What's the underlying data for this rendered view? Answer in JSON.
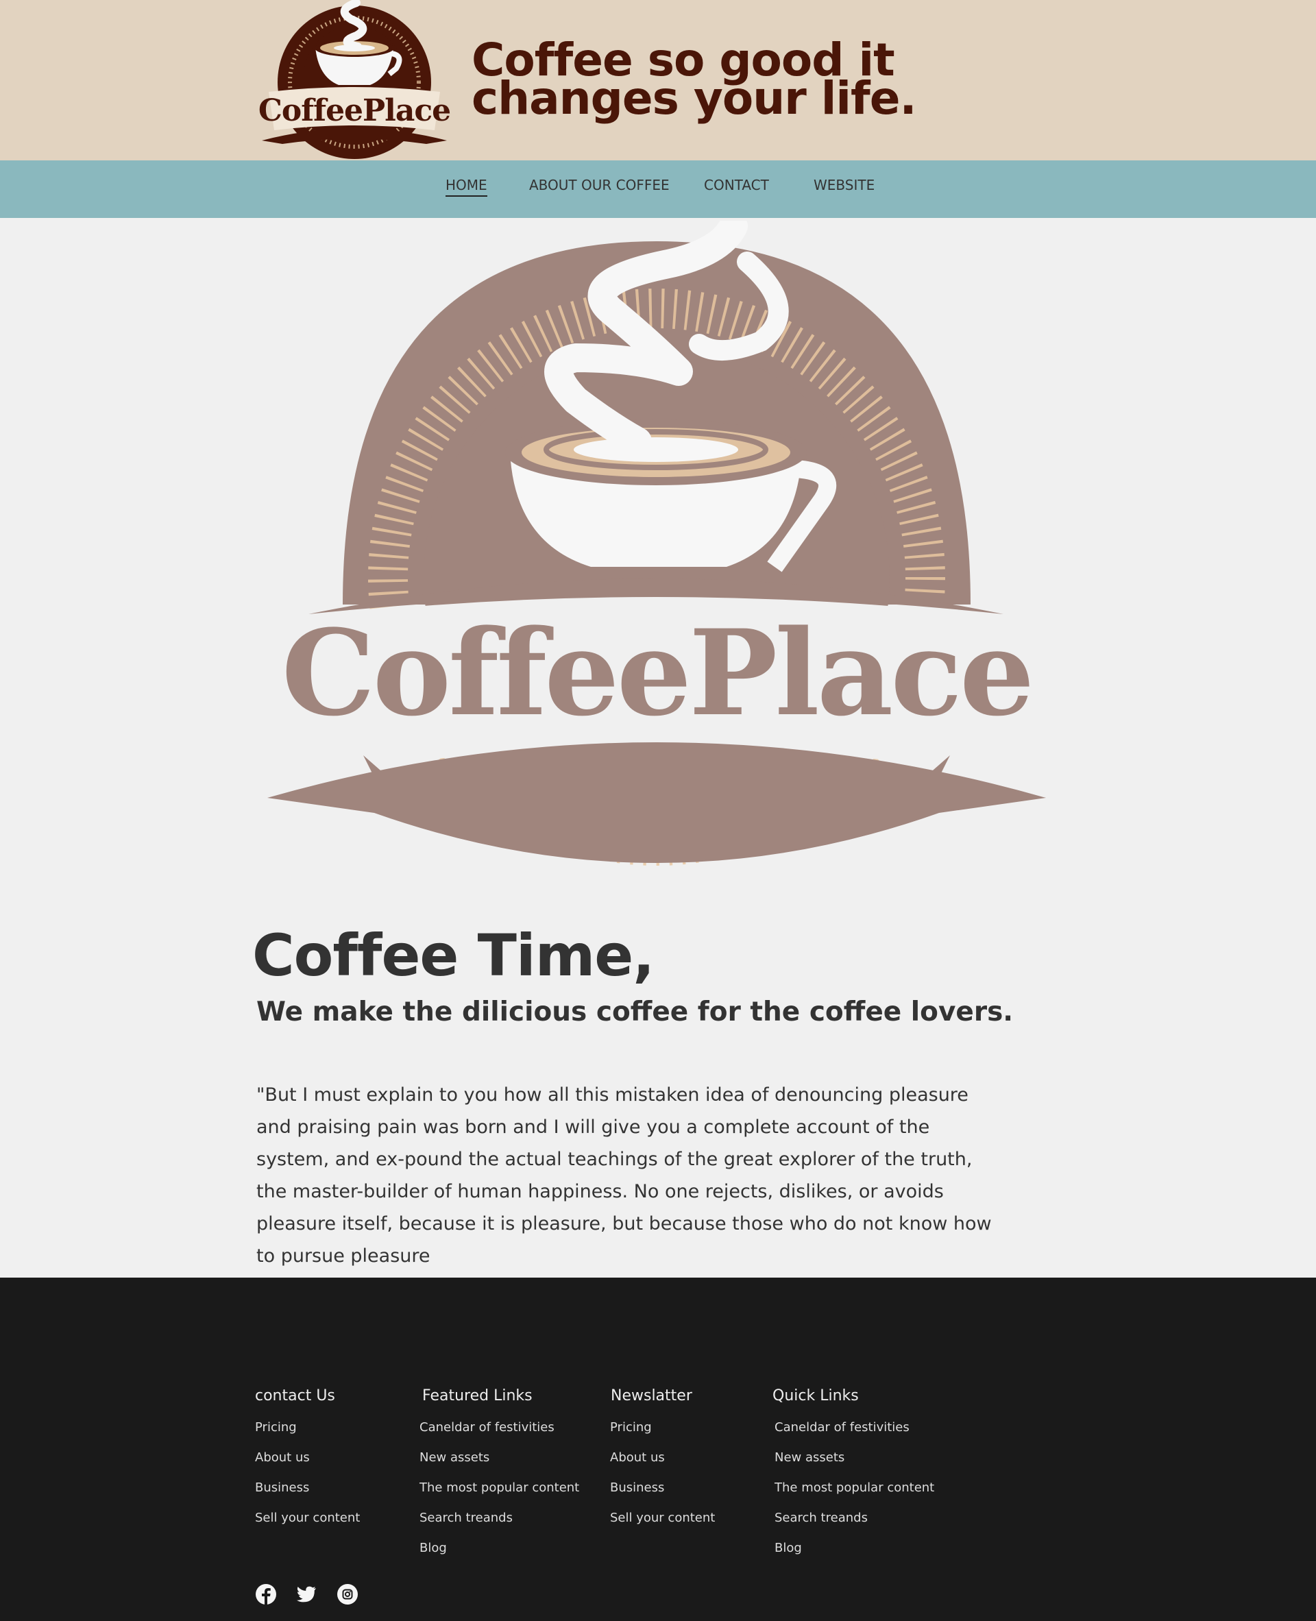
{
  "header": {
    "brand": "CoffeePlace",
    "tagline": "Coffee so good it changes your life."
  },
  "nav": {
    "items": [
      {
        "label": "HOME",
        "active": true
      },
      {
        "label": "ABOUT OUR COFFEE"
      },
      {
        "label": "CONTACT"
      },
      {
        "label": "WEBSITE"
      }
    ]
  },
  "hero": {
    "brand": "CoffeePlace"
  },
  "content": {
    "title": "Coffee Time,",
    "subtitle": "We make the dilicious coffee for the coffee lovers.",
    "body": "\"But I must explain to you how all this mistaken idea of denouncing pleasure and praising pain was born and I will give you a complete account of the system, and ex-pound the actual teachings of the great explorer of the truth, the master-builder of human happiness. No one rejects, dislikes, or avoids pleasure itself, because it is pleasure, but because those who do not know how to pursue pleasure"
  },
  "footer": {
    "columns": [
      {
        "heading": "contact Us",
        "links": [
          "Pricing",
          "About us",
          "Business",
          "Sell your content"
        ]
      },
      {
        "heading": "Featured Links",
        "links": [
          "Caneldar of festivities",
          "New assets",
          "The most popular content",
          "Search treands",
          "Blog"
        ]
      },
      {
        "heading": "Newslatter",
        "links": [
          "Pricing",
          "About us",
          "Business",
          "Sell your content"
        ]
      },
      {
        "heading": "Quick Links",
        "links": [
          "Caneldar of festivities",
          "New assets",
          "The most popular content",
          "Search treands",
          "Blog"
        ]
      }
    ],
    "social": [
      "facebook-icon",
      "twitter-icon",
      "instagram-icon"
    ]
  },
  "colors": {
    "header_bg": "#e2d3c0",
    "tagline": "#4a1608",
    "nav_bg": "#8ab8be",
    "page_bg": "#f0f0f0",
    "logo_dark": "#4a1608",
    "hero_logo": "#a0857d",
    "footer_bg": "#1a1a1a"
  }
}
